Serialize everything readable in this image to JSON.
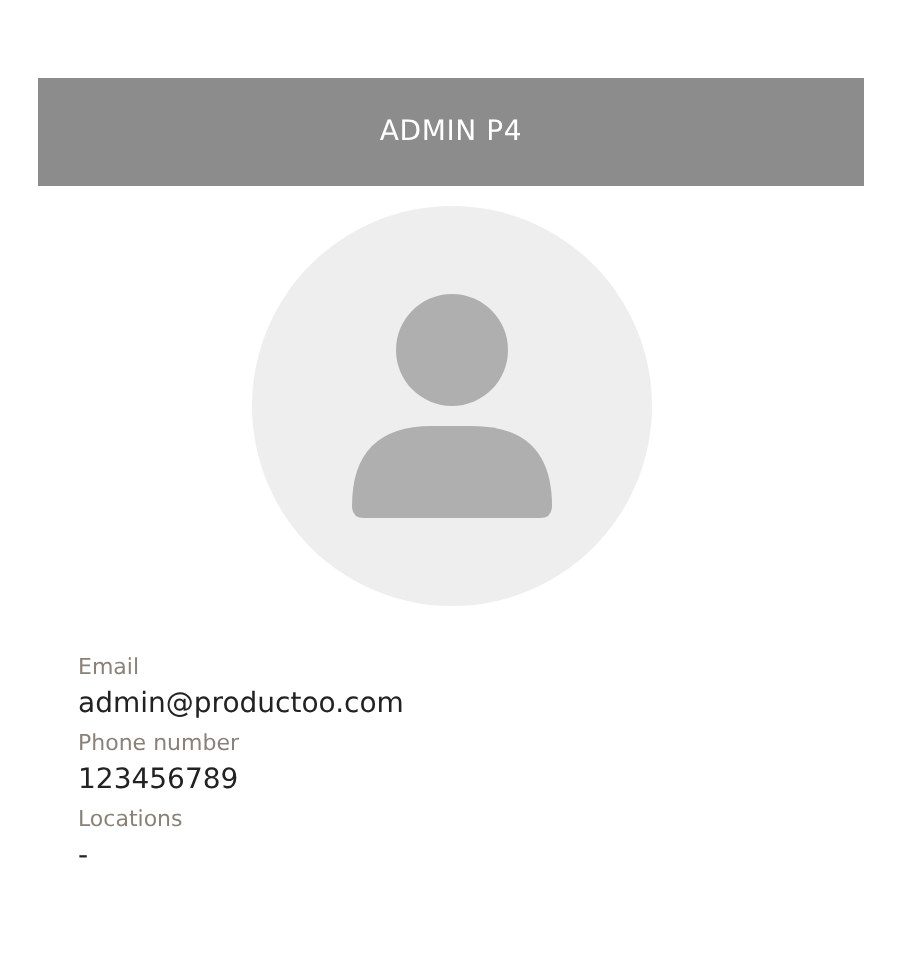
{
  "header": {
    "title": "ADMIN P4"
  },
  "avatar": {
    "kind": "placeholder"
  },
  "fields": [
    {
      "label": "Email",
      "value": "admin@productoo.com"
    },
    {
      "label": "Phone number",
      "value": "123456789"
    },
    {
      "label": "Locations",
      "value": "-"
    }
  ]
}
